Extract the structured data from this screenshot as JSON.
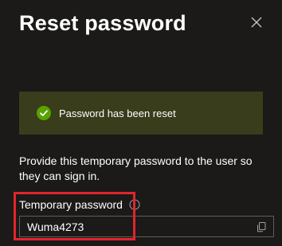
{
  "dialog": {
    "title": "Reset password",
    "close_icon": "close-icon"
  },
  "banner": {
    "icon": "success-check-icon",
    "message": "Password has been reset",
    "background": "#393d1b",
    "icon_color": "#57a300"
  },
  "description": "Provide this temporary password to the user so they can sign in.",
  "field": {
    "label": "Temporary password",
    "info_icon": "info-icon",
    "value": "Wuma4273",
    "copy_icon": "copy-icon"
  },
  "annotation": {
    "highlight_color": "#e3242b"
  }
}
